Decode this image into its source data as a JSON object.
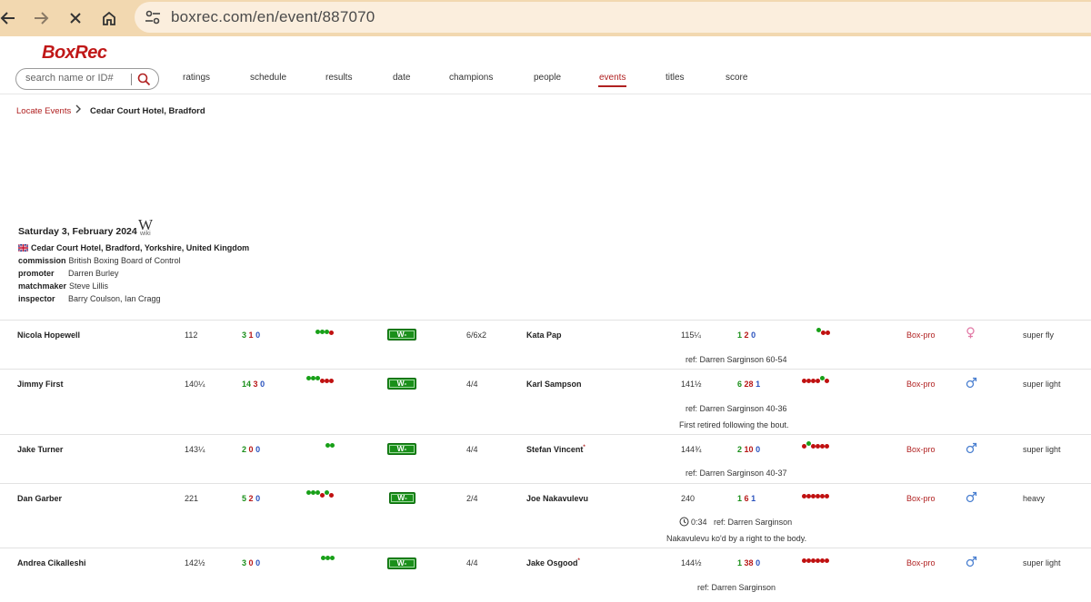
{
  "browser": {
    "url": "boxrec.com/en/event/887070"
  },
  "site": {
    "logo": "BoxRec",
    "search_placeholder": "search name or ID#",
    "menu": [
      {
        "label": "ratings"
      },
      {
        "label": "schedule"
      },
      {
        "label": "results"
      },
      {
        "label": "date"
      },
      {
        "label": "champions"
      },
      {
        "label": "people"
      },
      {
        "label": "events"
      },
      {
        "label": "titles"
      },
      {
        "label": "score"
      }
    ],
    "active_menu": "events",
    "accent_color": "#b02020"
  },
  "breadcrumb": {
    "link": "Locate Events",
    "current": "Cedar Court Hotel, Bradford"
  },
  "event": {
    "date": "Saturday 3, February 2024",
    "wiki_label": "wiki",
    "venue": "Cedar Court Hotel, Bradford, Yorkshire, United Kingdom",
    "details": [
      {
        "label": "commission",
        "value": "British Boxing Board of Control"
      },
      {
        "label": "promoter",
        "value": "Darren Burley"
      },
      {
        "label": "matchmaker",
        "value": "Steve Lillis"
      },
      {
        "label": "inspector",
        "value": "Barry Coulson, Ian Cragg"
      }
    ]
  },
  "bouts": [
    {
      "fighter": "Nicola Hopewell",
      "weight": "112",
      "rec_w": "3",
      "rec_l": "1",
      "rec_d": "0",
      "result": "W-PTS",
      "rounds": "6/6x2",
      "opponent": "Kata Pap",
      "opp_weight": "115¼",
      "opp_w": "1",
      "opp_l": "2",
      "opp_d": "0",
      "sanction": "Box-pro",
      "gender": "female",
      "division": "super fly",
      "ref": "ref: Darren Sarginson 60-54"
    },
    {
      "fighter": "Jimmy First",
      "weight": "140¼",
      "rec_w": "14",
      "rec_l": "3",
      "rec_d": "0",
      "result": "W-PTS",
      "rounds": "4/4",
      "opponent": "Karl Sampson",
      "opp_weight": "141½",
      "opp_w": "6",
      "opp_l": "28",
      "opp_d": "1",
      "sanction": "Box-pro",
      "gender": "male",
      "division": "super light",
      "ref": "ref: Darren Sarginson 40-36",
      "note": "First retired following the bout."
    },
    {
      "fighter": "Jake Turner",
      "weight": "143¼",
      "rec_w": "2",
      "rec_l": "0",
      "rec_d": "0",
      "result": "W-PTS",
      "rounds": "4/4",
      "opponent": "Stefan Vincent",
      "opp_weight": "144¾",
      "opp_w": "2",
      "opp_l": "10",
      "opp_d": "0",
      "sanction": "Box-pro",
      "gender": "male",
      "division": "super light",
      "ref": "ref: Darren Sarginson 40-37"
    },
    {
      "fighter": "Dan Garber",
      "weight": "221",
      "rec_w": "5",
      "rec_l": "2",
      "rec_d": "0",
      "result": "W-KO",
      "rounds": "2/4",
      "opponent": "Joe Nakavulevu",
      "opp_weight": "240",
      "opp_w": "1",
      "opp_l": "6",
      "opp_d": "1",
      "sanction": "Box-pro",
      "gender": "male",
      "division": "heavy",
      "time": "0:34",
      "ref": "ref: Darren Sarginson",
      "note": "Nakavulevu ko'd by a right to the body."
    },
    {
      "fighter": "Andrea Cikalleshi",
      "weight": "142½",
      "rec_w": "3",
      "rec_l": "0",
      "rec_d": "0",
      "result": "W-PTS",
      "rounds": "4/4",
      "opponent": "Jake Osgood",
      "opp_weight": "144½",
      "opp_w": "1",
      "opp_l": "38",
      "opp_d": "0",
      "sanction": "Box-pro",
      "gender": "male",
      "division": "super light",
      "ref": "ref: Darren Sarginson"
    }
  ]
}
